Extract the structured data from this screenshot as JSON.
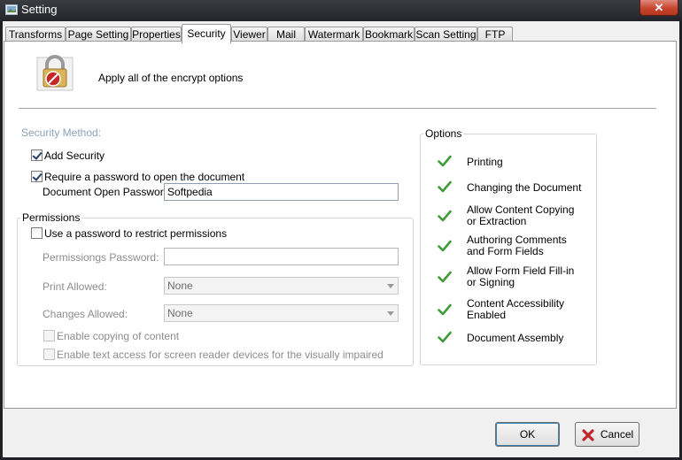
{
  "window": {
    "title": "Setting",
    "close_glyph": "✕"
  },
  "tabs": [
    {
      "label": "Transforms"
    },
    {
      "label": "Page Setting"
    },
    {
      "label": "Properties"
    },
    {
      "label": "Security"
    },
    {
      "label": "Viewer"
    },
    {
      "label": "Mail"
    },
    {
      "label": "Watermark"
    },
    {
      "label": "Bookmark"
    },
    {
      "label": "Scan Setting"
    },
    {
      "label": "FTP"
    }
  ],
  "active_tab": "Security",
  "header": {
    "icon": "padlock-icon",
    "text": "Apply all of the encrypt options"
  },
  "security_method": {
    "title": "Security Method:",
    "add_security": {
      "label": "Add Security",
      "checked": true
    },
    "require_open_password": {
      "label": "Require a password to open the document",
      "checked": true
    },
    "open_password": {
      "label": "Document Open Password",
      "value": "Softpedia"
    }
  },
  "permissions": {
    "title": "Permissions",
    "use_password": {
      "label": "Use a password to restrict permissions",
      "checked": false
    },
    "permissions_password": {
      "label": "Permissiongs Password:",
      "value": ""
    },
    "print_allowed": {
      "label": "Print Allowed:",
      "value": "None"
    },
    "changes_allowed": {
      "label": "Changes Allowed:",
      "value": "None"
    },
    "enable_copying": {
      "label": "Enable copying of content",
      "checked": false
    },
    "enable_text_access": {
      "label": "Enable text access for screen reader devices for the visually impaired",
      "checked": false
    }
  },
  "options": {
    "title": "Options",
    "items": [
      {
        "line1": "Printing",
        "line2": ""
      },
      {
        "line1": "Changing the Document",
        "line2": ""
      },
      {
        "line1": "Allow Content Copying",
        "line2": "or Extraction"
      },
      {
        "line1": "Authoring Comments",
        "line2": "and Form Fields"
      },
      {
        "line1": "Allow Form Field Fill-in",
        "line2": "or Signing"
      },
      {
        "line1": "Content Accessibility",
        "line2": "Enabled"
      },
      {
        "line1": "Document Assembly",
        "line2": ""
      }
    ],
    "check_color": "#3f9a3a"
  },
  "buttons": {
    "ok": "OK",
    "cancel": "Cancel"
  },
  "colors": {
    "cancel_icon": "#c0272d",
    "section_label": "#8ea3bd"
  }
}
